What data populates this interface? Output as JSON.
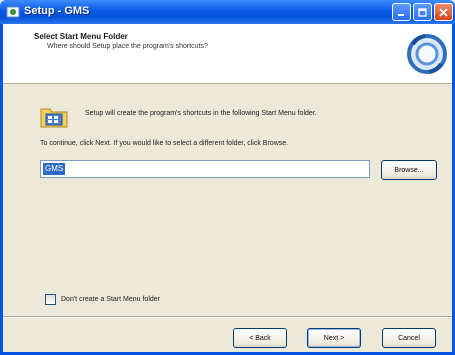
{
  "window": {
    "title": "Setup - GMS",
    "icons": {
      "app": "setup-icon",
      "minimize": "minimize-icon",
      "maximize": "maximize-icon",
      "close": "close-icon"
    }
  },
  "header": {
    "title": "Select Start Menu Folder",
    "subtitle": "Where should Setup place the program's shortcuts?",
    "image_icon": "setup-wizard-icon"
  },
  "body": {
    "info_text": "Setup will create the program's shortcuts in the following Start Menu folder.",
    "info_icon": "start-menu-folder-icon",
    "continue_text": "To continue, click Next. If you would like to select a different folder, click Browse.",
    "folder_value": "GMS",
    "browse_label": "Browse...",
    "checkbox_label": "Don't create a Start Menu folder",
    "checkbox_checked": false
  },
  "footer": {
    "back_label": "< Back",
    "next_label": "Next >",
    "cancel_label": "Cancel"
  },
  "colors": {
    "titlebar": "#0a5ae6",
    "selection": "#316ac5",
    "dialog_bg": "#ece9d8"
  }
}
